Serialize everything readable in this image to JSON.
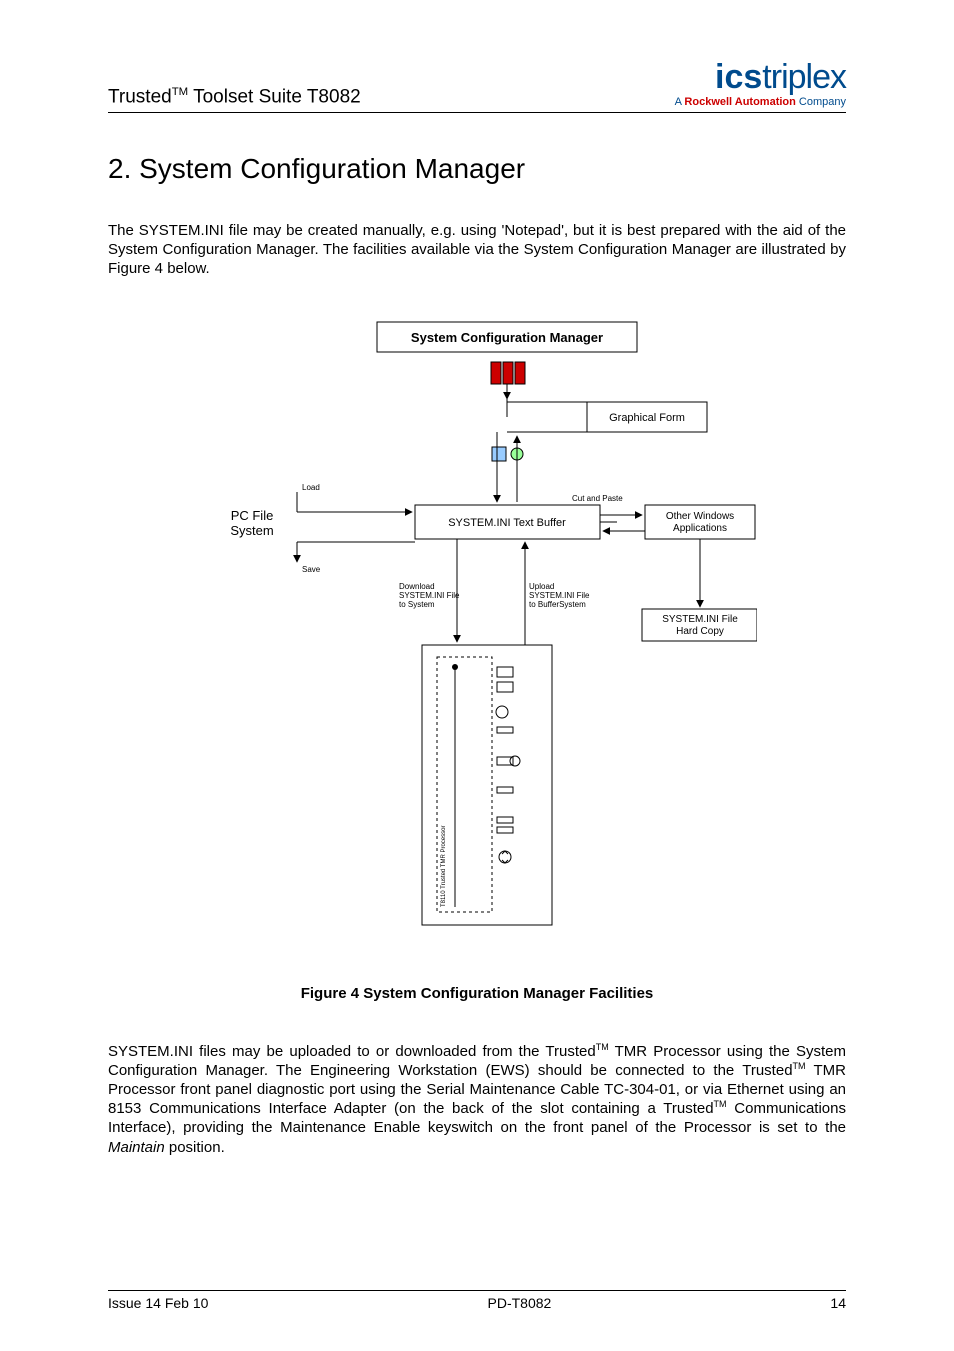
{
  "header": {
    "product_line_pre": "Trusted",
    "product_line_tm": "TM",
    "product_line_post": " Toolset Suite T8082",
    "logo_brand_a": "ics",
    "logo_brand_b": "triplex",
    "logo_tag_pre": "A ",
    "logo_tag_rockwell": "Rockwell Automation",
    "logo_tag_post": " Company"
  },
  "heading": "2. System Configuration Manager",
  "para1": "The SYSTEM.INI file may be created manually, e.g. using 'Notepad', but it is best prepared with the aid of the System Configuration Manager. The facilities available via the System Configuration Manager are illustrated by Figure 4 below.",
  "diagram": {
    "title": "System Configuration Manager",
    "graphical_form": "Graphical Form",
    "pc_file_system_1": "PC File",
    "pc_file_system_2": "System",
    "load": "Load",
    "save": "Save",
    "text_buffer": "SYSTEM.INI Text Buffer",
    "cut_paste": "Cut and Paste",
    "other_apps_1": "Other Windows",
    "other_apps_2": "Applications",
    "download_1": "Download",
    "download_2": "SYSTEM.INI File",
    "download_3": "to System",
    "upload_1": "Upload",
    "upload_2": "SYSTEM.INI File",
    "upload_3": "to BufferSystem",
    "hardcopy_1": "SYSTEM.INI File",
    "hardcopy_2": "Hard Copy",
    "module_label": "T8110 Trusted TMR Processor"
  },
  "figure_caption": "Figure 4 System Configuration Manager Facilities",
  "para2_a": "SYSTEM.INI files may be uploaded to or downloaded from the Trusted",
  "para2_b": " TMR Processor using the System Configuration Manager. The Engineering Workstation (EWS) should be connected to the Trusted",
  "para2_c": " TMR Processor front panel diagnostic port using the Serial Maintenance Cable TC-304-01, or via Ethernet using an 8153 Communications Interface Adapter (on the back of the slot containing a Trusted",
  "para2_d": " Communications Interface), providing the Maintenance Enable keyswitch on the front panel of the Processor is set to the ",
  "para2_maintain": "Maintain",
  "para2_e": " position.",
  "tm": "TM",
  "footer": {
    "left": "Issue 14 Feb 10",
    "center": "PD-T8082",
    "right": "14"
  }
}
